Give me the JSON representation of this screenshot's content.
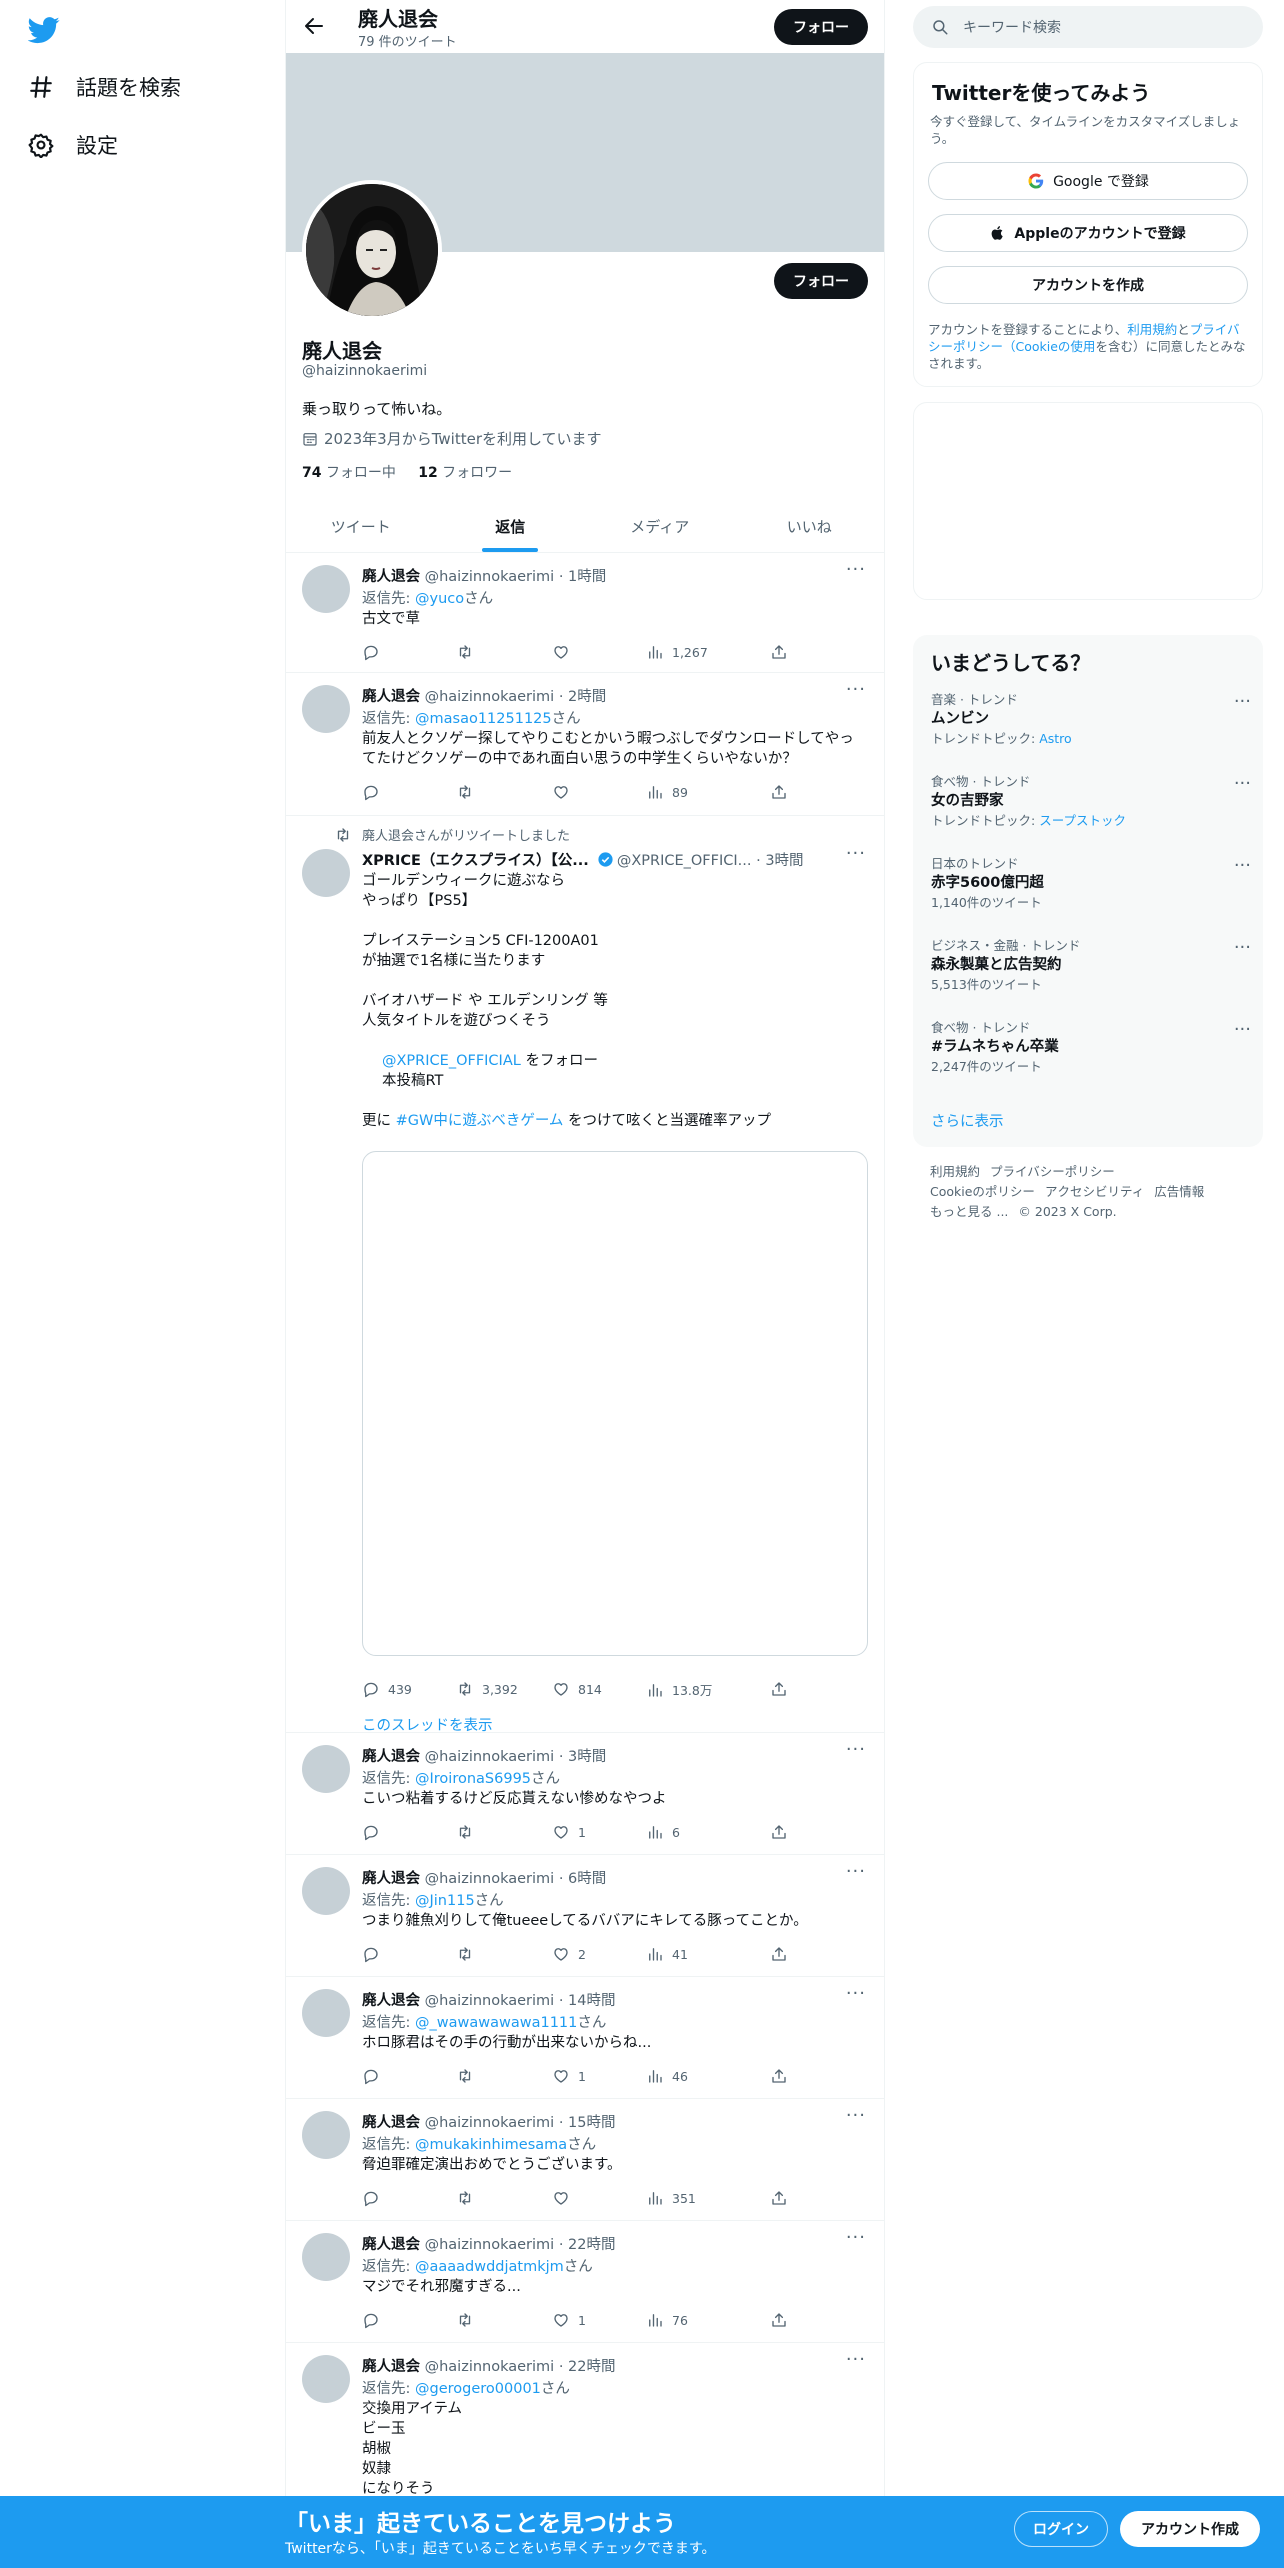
{
  "nav": {
    "explore": "話題を検索",
    "settings": "設定"
  },
  "header": {
    "name": "廃人退会",
    "tweet_count": "79 件のツイート",
    "follow": "フォロー"
  },
  "profile": {
    "name": "廃人退会",
    "handle": "@haizinnokaerimi",
    "bio": "乗っ取りって怖いね。",
    "joined": "2023年3月からTwitterを利用しています",
    "following_count": "74",
    "following_label": "フォロー中",
    "followers_count": "12",
    "followers_label": "フォロワー",
    "follow": "フォロー"
  },
  "tabs": [
    "ツイート",
    "返信",
    "メディア",
    "いいね"
  ],
  "tweets": [
    {
      "name": "廃人退会",
      "handle": "@haizinnokaerimi",
      "time": "· 1時間",
      "reply_prefix": "返信先: ",
      "reply_to": "@yuco",
      "reply_suffix": "さん",
      "text": "古文で草",
      "replies": "",
      "retweets": "",
      "likes": "",
      "views": "1,267"
    },
    {
      "name": "廃人退会",
      "handle": "@haizinnokaerimi",
      "time": "· 2時間",
      "reply_prefix": "返信先: ",
      "reply_to": "@masao11251125",
      "reply_suffix": "さん",
      "text": "前友人とクソゲー探してやりこむとかいう暇つぶしでダウンロードしてやってたけどクソゲーの中であれ面白い思うの中学生くらいやないか？",
      "replies": "",
      "retweets": "",
      "likes": "",
      "views": "89"
    },
    {
      "retweet_note": "廃人退会さんがリツイートしました",
      "name": "XPRICE（エクスプライス）【公...",
      "handle": "@XPRICE_OFFICI...",
      "time": "· 3時間",
      "lines": [
        "ゴールデンウィークに遊ぶなら",
        "やっぱり【PS5】",
        "",
        "プレイステーション5 CFI-1200A01",
        "が抽選で1名様に当たります",
        "",
        "バイオハザード や エルデンリング 等",
        "人気タイトルを遊びつくそう"
      ],
      "follow_link": "@XPRICE_OFFICIAL",
      "follow_text": " をフォロー",
      "rt_text": "本投稿RT",
      "hashtag_prefix": "更に ",
      "hashtag": "#GW中に遊ぶべきゲーム",
      "hashtag_suffix": " をつけて呟くと当選確率アップ",
      "replies": "439",
      "retweets": "3,392",
      "likes": "814",
      "views": "13.8万",
      "show_thread": "このスレッドを表示"
    },
    {
      "name": "廃人退会",
      "handle": "@haizinnokaerimi",
      "time": "· 3時間",
      "reply_prefix": "返信先: ",
      "reply_to": "@IroironaS6995",
      "reply_suffix": "さん",
      "text": "こいつ粘着するけど反応貰えない惨めなやつよ",
      "replies": "",
      "retweets": "",
      "likes": "1",
      "views": "6"
    },
    {
      "name": "廃人退会",
      "handle": "@haizinnokaerimi",
      "time": "· 6時間",
      "reply_prefix": "返信先: ",
      "reply_to": "@Jin115",
      "reply_suffix": "さん",
      "text": "つまり雑魚刈りして俺tueeeしてるババアにキレてる豚ってことか。",
      "replies": "",
      "retweets": "",
      "likes": "2",
      "views": "41"
    },
    {
      "name": "廃人退会",
      "handle": "@haizinnokaerimi",
      "time": "· 14時間",
      "reply_prefix": "返信先: ",
      "reply_to": "@_wawawawawa1111",
      "reply_suffix": "さん",
      "text": "ホロ豚君はその手の行動が出来ないからね...",
      "replies": "",
      "retweets": "",
      "likes": "1",
      "views": "46"
    },
    {
      "name": "廃人退会",
      "handle": "@haizinnokaerimi",
      "time": "· 15時間",
      "reply_prefix": "返信先: ",
      "reply_to": "@mukakinhimesama",
      "reply_suffix": "さん",
      "text": "脅迫罪確定演出おめでとうございます。",
      "replies": "",
      "retweets": "",
      "likes": "",
      "views": "351"
    },
    {
      "name": "廃人退会",
      "handle": "@haizinnokaerimi",
      "time": "· 22時間",
      "reply_prefix": "返信先: ",
      "reply_to": "@aaaadwddjatmkjm",
      "reply_suffix": "さん",
      "text": "マジでそれ邪魔すぎる...",
      "replies": "",
      "retweets": "",
      "likes": "1",
      "views": "76"
    },
    {
      "name": "廃人退会",
      "handle": "@haizinnokaerimi",
      "time": "· 22時間",
      "reply_prefix": "返信先: ",
      "reply_to": "@gerogero00001",
      "reply_suffix": "さん",
      "lines": [
        "交換用アイテム",
        "ビー玉",
        "胡椒",
        "奴隷",
        "になりそう"
      ]
    }
  ],
  "search": {
    "placeholder": "キーワード検索"
  },
  "signup": {
    "title": "Twitterを使ってみよう",
    "subtitle": "今すぐ登録して、タイムラインをカスタマイズしましょう。",
    "google": "Google で登録",
    "apple": "Appleのアカウントで登録",
    "create": "アカウントを作成",
    "terms_1": "アカウントを登録することにより、",
    "terms_link1": "利用規約",
    "terms_2": "と",
    "terms_link2": "プライバシーポリシー（Cookieの使用",
    "terms_3": "を含む）に同意したとみなされます。"
  },
  "trends": {
    "title": "いまどうしてる？",
    "items": [
      {
        "category": "音楽 · トレンド",
        "name": "ムンビン",
        "sub_prefix": "トレンドトピック: ",
        "sub_link": "Astro"
      },
      {
        "category": "食べ物 · トレンド",
        "name": "女の吉野家",
        "sub_prefix": "トレンドトピック: ",
        "sub_link": "スープストック"
      },
      {
        "category": "日本のトレンド",
        "name": "赤字5600億円超",
        "sub_prefix": "1,140件のツイート",
        "sub_link": ""
      },
      {
        "category": "ビジネス・金融 · トレンド",
        "name": "森永製菓と広告契約",
        "sub_prefix": "5,513件のツイート",
        "sub_link": ""
      },
      {
        "category": "食べ物 · トレンド",
        "name": "#ラムネちゃん卒業",
        "sub_prefix": "2,247件のツイート",
        "sub_link": ""
      }
    ],
    "show_more": "さらに表示"
  },
  "footer": [
    "利用規約",
    "プライバシーポリシー",
    "Cookieのポリシー",
    "アクセシビリティ",
    "広告情報",
    "もっと見る ...",
    "© 2023 X Corp."
  ],
  "bottombar": {
    "title": "「いま」起きていることを見つけよう",
    "subtitle": "Twitterなら、「いま」起きていることをいち早くチェックできます。",
    "login": "ログイン",
    "signup": "アカウント作成"
  },
  "colors": {
    "accent": "#1d9bf0",
    "text": "#0f1419",
    "muted": "#536471",
    "banner": "#cfd9de"
  }
}
